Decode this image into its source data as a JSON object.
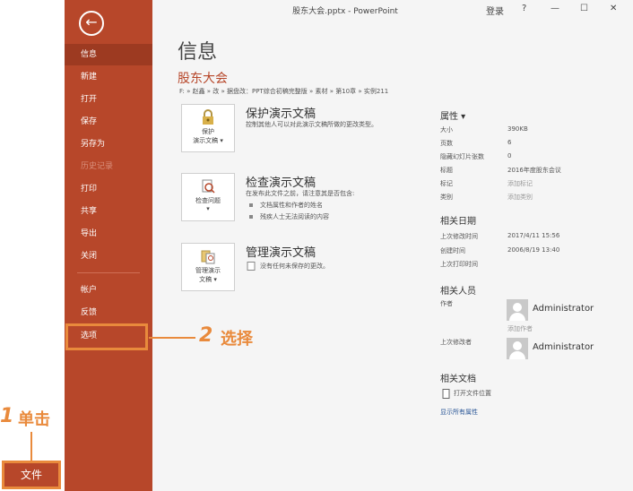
{
  "window": {
    "title": "股东大会.pptx - PowerPoint",
    "login_label": "登录",
    "help_label": "?",
    "minimize_label": "—",
    "maximize_label": "☐",
    "close_label": "✕"
  },
  "sidebar": {
    "back_icon": "←",
    "items": [
      {
        "label": "信息"
      },
      {
        "label": "新建"
      },
      {
        "label": "打开"
      },
      {
        "label": "保存"
      },
      {
        "label": "另存为"
      },
      {
        "label": "历史记录"
      },
      {
        "label": "打印"
      },
      {
        "label": "共享"
      },
      {
        "label": "导出"
      },
      {
        "label": "关闭"
      },
      {
        "label": "帐户"
      },
      {
        "label": "反馈"
      },
      {
        "label": "选项"
      }
    ]
  },
  "main": {
    "page_title": "信息",
    "doc_name": "股东大会",
    "doc_path": "F: » 赵鑫 » 改 » 据盘改：PPT综合初稿完整版 » 素材 » 第10章 » 实例211",
    "sections": [
      {
        "button_label_1": "保护",
        "button_label_2": "演示文稿 ▾",
        "title": "保护演示文稿",
        "desc": "控制其他人可以对此演示文稿所做的更改类型。"
      },
      {
        "button_label_1": "检查问题",
        "button_label_2": "▾",
        "title": "检查演示文稿",
        "desc": "在发布此文件之前，请注意其是否包含:",
        "bullets": [
          "文档属性和作者的姓名",
          "残疾人士无法阅读的内容"
        ]
      },
      {
        "button_label_1": "管理演示",
        "button_label_2": "文稿 ▾",
        "title": "管理演示文稿",
        "desc": "没有任何未保存的更改。"
      }
    ]
  },
  "properties": {
    "heading": "属性 ▾",
    "rows": [
      {
        "label": "大小",
        "value": "390KB"
      },
      {
        "label": "页数",
        "value": "6"
      },
      {
        "label": "隐藏幻灯片张数",
        "value": "0"
      },
      {
        "label": "标题",
        "value": "2016年度股东会议"
      },
      {
        "label": "标记",
        "value": "添加标记"
      },
      {
        "label": "类别",
        "value": "添加类别"
      }
    ],
    "dates_heading": "相关日期",
    "dates": [
      {
        "label": "上次修改时间",
        "value": "2017/4/11 15:56"
      },
      {
        "label": "创建时间",
        "value": "2006/8/19 13:40"
      },
      {
        "label": "上次打印时间",
        "value": ""
      }
    ],
    "people_heading": "相关人员",
    "author_label": "作者",
    "author_name": "Administrator",
    "add_author": "添加作者",
    "last_modified_by_label": "上次修改者",
    "last_modified_by_name": "Administrator",
    "docs_heading": "相关文档",
    "open_location": "打开文件位置",
    "show_all": "显示所有属性"
  },
  "annotations": {
    "step1_num": "1",
    "step1_text": "单击",
    "step2_num": "2",
    "step2_text": "选择",
    "file_button": "文件"
  },
  "colors": {
    "accent": "#b7472a",
    "annotation": "#e98a3c"
  }
}
